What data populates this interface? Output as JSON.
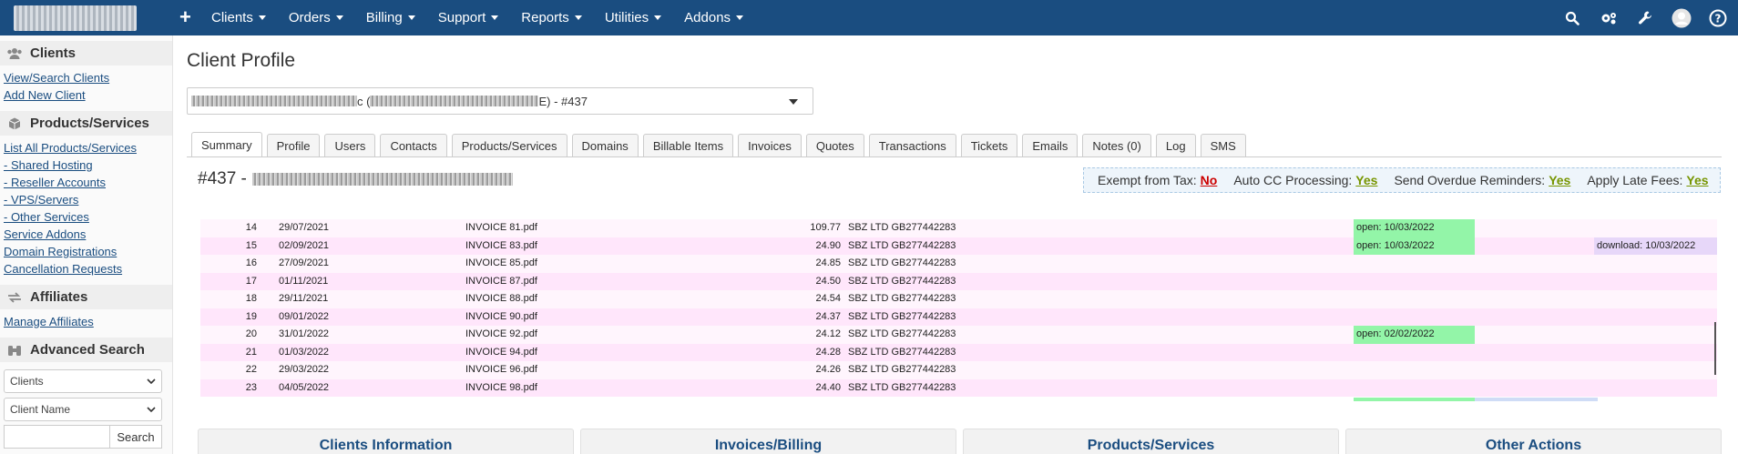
{
  "nav": {
    "plus": "+",
    "items": [
      "Clients",
      "Orders",
      "Billing",
      "Support",
      "Reports",
      "Utilities",
      "Addons"
    ],
    "right_icons": [
      "search-icon",
      "settings-icon",
      "wrench-icon",
      "user-avatar-icon",
      "help-icon"
    ]
  },
  "sidebar": {
    "clients": {
      "title": "Clients",
      "links": [
        "View/Search Clients",
        "Add New Client"
      ]
    },
    "products": {
      "title": "Products/Services",
      "links": [
        "List All Products/Services",
        "- Shared Hosting",
        "- Reseller Accounts",
        "- VPS/Servers",
        "- Other Services",
        "Service Addons",
        "Domain Registrations",
        "Cancellation Requests"
      ]
    },
    "affiliates": {
      "title": "Affiliates",
      "links": [
        "Manage Affiliates"
      ]
    },
    "advanced": {
      "title": "Advanced Search",
      "select1": "Clients",
      "select2": "Client Name",
      "search_button": "Search"
    }
  },
  "main": {
    "title": "Client Profile",
    "client_select": {
      "visible_fragment": "c (",
      "visible_fragment2": "E) - #437"
    },
    "tabs": [
      "Summary",
      "Profile",
      "Users",
      "Contacts",
      "Products/Services",
      "Domains",
      "Billable Items",
      "Invoices",
      "Quotes",
      "Transactions",
      "Tickets",
      "Emails",
      "Notes (0)",
      "Log",
      "SMS"
    ],
    "active_tab": "Summary",
    "profile_id": "#437 -",
    "flags": {
      "exempt_label": "Exempt from Tax:",
      "exempt_value": "No",
      "autocc_label": "Auto CC Processing:",
      "autocc_value": "Yes",
      "overdue_label": "Send Overdue Reminders:",
      "overdue_value": "Yes",
      "late_label": "Apply Late Fees:",
      "late_value": "Yes"
    },
    "rows": [
      {
        "n": "14",
        "date": "29/07/2021",
        "file": "INVOICE 81.pdf",
        "amount": "109.77",
        "company": "SBZ LTD GB277442283",
        "open": "open: 10/03/2022",
        "download": ""
      },
      {
        "n": "15",
        "date": "02/09/2021",
        "file": "INVOICE 83.pdf",
        "amount": "24.90",
        "company": "SBZ LTD GB277442283",
        "open": "open: 10/03/2022",
        "download": "download: 10/03/2022"
      },
      {
        "n": "16",
        "date": "27/09/2021",
        "file": "INVOICE 85.pdf",
        "amount": "24.85",
        "company": "SBZ LTD GB277442283",
        "open": "",
        "download": ""
      },
      {
        "n": "17",
        "date": "01/11/2021",
        "file": "INVOICE 87.pdf",
        "amount": "24.50",
        "company": "SBZ LTD GB277442283",
        "open": "",
        "download": ""
      },
      {
        "n": "18",
        "date": "29/11/2021",
        "file": "INVOICE 88.pdf",
        "amount": "24.54",
        "company": "SBZ LTD GB277442283",
        "open": "",
        "download": ""
      },
      {
        "n": "19",
        "date": "09/01/2022",
        "file": "INVOICE 90.pdf",
        "amount": "24.37",
        "company": "SBZ LTD GB277442283",
        "open": "",
        "download": ""
      },
      {
        "n": "20",
        "date": "31/01/2022",
        "file": "INVOICE 92.pdf",
        "amount": "24.12",
        "company": "SBZ LTD GB277442283",
        "open": "open: 02/02/2022",
        "download": ""
      },
      {
        "n": "21",
        "date": "01/03/2022",
        "file": "INVOICE 94.pdf",
        "amount": "24.28",
        "company": "SBZ LTD GB277442283",
        "open": "",
        "download": ""
      },
      {
        "n": "22",
        "date": "29/03/2022",
        "file": "INVOICE 96.pdf",
        "amount": "24.26",
        "company": "SBZ LTD GB277442283",
        "open": "",
        "download": ""
      },
      {
        "n": "23",
        "date": "04/05/2022",
        "file": "INVOICE 98.pdf",
        "amount": "24.40",
        "company": "SBZ LTD GB277442283",
        "open": "",
        "download": ""
      }
    ],
    "panels": [
      "Clients Information",
      "Invoices/Billing",
      "Products/Services",
      "Other Actions"
    ]
  },
  "colors": {
    "navbar": "#1a4d80",
    "open_badge": "#93f5a8",
    "download_badge": "#e7d7f9",
    "no_flag": "#cc0000",
    "yes_flag": "#779500"
  }
}
